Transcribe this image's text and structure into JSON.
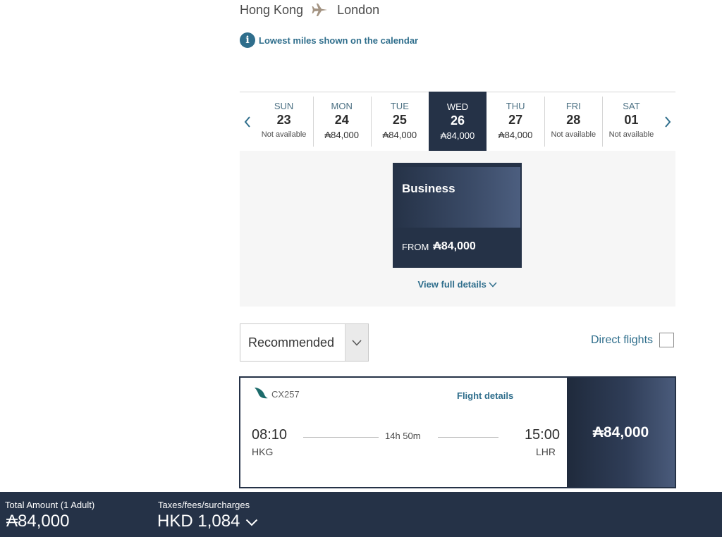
{
  "route": {
    "origin": "Hong Kong",
    "destination": "London"
  },
  "notice": {
    "text": "Lowest miles shown on the calendar"
  },
  "calendar": {
    "days": [
      {
        "name": "SUN",
        "date": "23",
        "miles": "Not available"
      },
      {
        "name": "MON",
        "date": "24",
        "miles": "₳84,000"
      },
      {
        "name": "TUE",
        "date": "25",
        "miles": "₳84,000"
      },
      {
        "name": "WED",
        "date": "26",
        "miles": "₳84,000"
      },
      {
        "name": "THU",
        "date": "27",
        "miles": "₳84,000"
      },
      {
        "name": "FRI",
        "date": "28",
        "miles": "Not available"
      },
      {
        "name": "SAT",
        "date": "01",
        "miles": "Not available"
      }
    ]
  },
  "cabin": {
    "name": "Business",
    "from_label": "FROM",
    "price": "₳84,000",
    "view_details": "View full details"
  },
  "sort": {
    "value": "Recommended"
  },
  "direct": {
    "label": "Direct flights"
  },
  "flight": {
    "number": "CX257",
    "details_link": "Flight details",
    "departure_time": "08:10",
    "departure_code": "HKG",
    "arrival_time": "15:00",
    "arrival_code": "LHR",
    "duration": "14h 50m",
    "price": "₳84,000"
  },
  "footer": {
    "total_label": "Total Amount (1 Adult)",
    "total_value": "₳84,000",
    "taxes_label": "Taxes/fees/surcharges",
    "taxes_value": "HKD 1,084"
  },
  "colors": {
    "brand_navy": "#253247",
    "link_teal": "#2f6e8c"
  }
}
